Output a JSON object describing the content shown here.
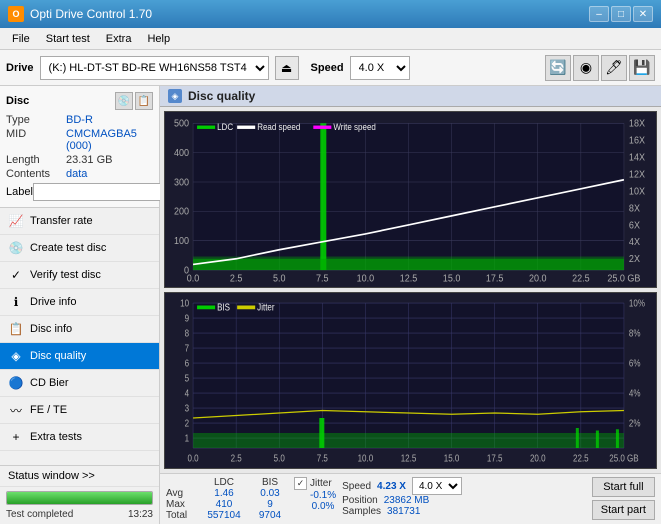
{
  "titlebar": {
    "title": "Opti Drive Control 1.70",
    "icon_text": "O",
    "btn_minimize": "–",
    "btn_maximize": "□",
    "btn_close": "✕"
  },
  "menubar": {
    "items": [
      "File",
      "Start test",
      "Extra",
      "Help"
    ]
  },
  "drivebar": {
    "label": "Drive",
    "drive_value": "(K:)  HL-DT-ST BD-RE  WH16NS58 TST4",
    "eject_icon": "⏏",
    "speed_label": "Speed",
    "speed_value": "4.0 X",
    "icon1": "🔄",
    "icon2": "◉",
    "icon3": "🖋",
    "icon4": "💾"
  },
  "disc": {
    "title": "Disc",
    "type_label": "Type",
    "type_value": "BD-R",
    "mid_label": "MID",
    "mid_value": "CMCMAGBA5 (000)",
    "length_label": "Length",
    "length_value": "23.31 GB",
    "contents_label": "Contents",
    "contents_value": "data",
    "label_label": "Label",
    "label_value": ""
  },
  "nav": {
    "items": [
      {
        "id": "transfer-rate",
        "label": "Transfer rate",
        "icon": "📈"
      },
      {
        "id": "create-test-disc",
        "label": "Create test disc",
        "icon": "💿"
      },
      {
        "id": "verify-test-disc",
        "label": "Verify test disc",
        "icon": "✓"
      },
      {
        "id": "drive-info",
        "label": "Drive info",
        "icon": "ℹ"
      },
      {
        "id": "disc-info",
        "label": "Disc info",
        "icon": "📋"
      },
      {
        "id": "disc-quality",
        "label": "Disc quality",
        "icon": "◈",
        "active": true
      },
      {
        "id": "cd-bier",
        "label": "CD Bier",
        "icon": "🔵"
      },
      {
        "id": "fe-te",
        "label": "FE / TE",
        "icon": "〰"
      },
      {
        "id": "extra-tests",
        "label": "Extra tests",
        "icon": "+"
      }
    ]
  },
  "status": {
    "window_label": "Status window >>",
    "progress_percent": 100,
    "progress_text": "Test completed",
    "time": "13:23"
  },
  "content": {
    "header_title": "Disc quality",
    "header_icon": "◈"
  },
  "chart_top": {
    "legend": [
      {
        "label": "LDC",
        "color": "#00ff00"
      },
      {
        "label": "Read speed",
        "color": "#ffffff"
      },
      {
        "label": "Write speed",
        "color": "#ff00ff"
      }
    ],
    "y_max": 500,
    "y_labels_left": [
      "500",
      "400",
      "300",
      "200",
      "100",
      "0"
    ],
    "y_labels_right": [
      "18X",
      "16X",
      "14X",
      "12X",
      "10X",
      "8X",
      "6X",
      "4X",
      "2X"
    ],
    "x_labels": [
      "0.0",
      "2.5",
      "5.0",
      "7.5",
      "10.0",
      "12.5",
      "15.0",
      "17.5",
      "20.0",
      "22.5",
      "25.0 GB"
    ]
  },
  "chart_bottom": {
    "legend": [
      {
        "label": "BIS",
        "color": "#00ff00"
      },
      {
        "label": "Jitter",
        "color": "#ffff00"
      }
    ],
    "y_max": 10,
    "y_labels_left": [
      "10",
      "9",
      "8",
      "7",
      "6",
      "5",
      "4",
      "3",
      "2",
      "1"
    ],
    "y_labels_right": [
      "10%",
      "8%",
      "6%",
      "4%",
      "2%"
    ],
    "x_labels": [
      "0.0",
      "2.5",
      "5.0",
      "7.5",
      "10.0",
      "12.5",
      "15.0",
      "17.5",
      "20.0",
      "22.5",
      "25.0 GB"
    ]
  },
  "data_table": {
    "col_headers": [
      "",
      "LDC",
      "BIS",
      "",
      "Jitter",
      "Speed",
      ""
    ],
    "row_avg": {
      "label": "Avg",
      "ldc": "1.46",
      "bis": "0.03",
      "jitter": "-0.1%",
      "speed_label": "Speed",
      "speed_val": "4.23 X"
    },
    "row_max": {
      "label": "Max",
      "ldc": "410",
      "bis": "9",
      "jitter": "0.0%",
      "position_label": "Position",
      "position_val": "23862 MB"
    },
    "row_total": {
      "label": "Total",
      "ldc": "557104",
      "bis": "9704",
      "samples_label": "Samples",
      "samples_val": "381731"
    },
    "jitter_checked": true,
    "jitter_label": "Jitter",
    "speed_display": "4.0 X",
    "start_full_label": "Start full",
    "start_part_label": "Start part"
  }
}
